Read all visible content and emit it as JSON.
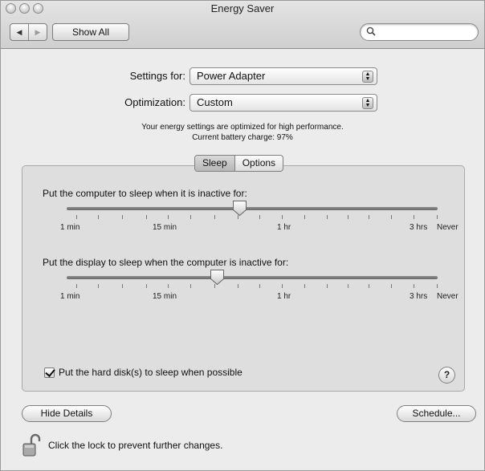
{
  "window": {
    "title": "Energy Saver"
  },
  "toolbar": {
    "back_glyph": "◀",
    "forward_glyph": "▶",
    "show_all_label": "Show All",
    "search_value": "",
    "search_placeholder": "",
    "search_icon": "magnifier-icon"
  },
  "settings": {
    "settings_for_label": "Settings for:",
    "settings_for_value": "Power Adapter",
    "optimization_label": "Optimization:",
    "optimization_value": "Custom",
    "info_line1": "Your energy settings are optimized for high performance.",
    "info_line2": "Current battery charge: 97%"
  },
  "tabs": [
    {
      "label": "Sleep",
      "active": true
    },
    {
      "label": "Options",
      "active": false
    }
  ],
  "sleep": {
    "computer_label": "Put the computer to sleep when it is inactive for:",
    "display_label": "Put the display to sleep when the computer is inactive for:",
    "scale_labels": [
      "1 min",
      "15 min",
      "1 hr",
      "3 hrs",
      "Never"
    ],
    "computer_slider_fraction": 0.465,
    "display_slider_fraction": 0.405,
    "hard_disk_label": "Put the hard disk(s) to sleep when possible",
    "hard_disk_checked": true,
    "help_label": "?"
  },
  "footer": {
    "hide_details_label": "Hide Details",
    "schedule_label": "Schedule...",
    "lock_message": "Click the lock to prevent further changes."
  },
  "colors": {
    "window_bg": "#ececec",
    "pane_bg": "#dedede",
    "track": "#7a7a7a"
  }
}
